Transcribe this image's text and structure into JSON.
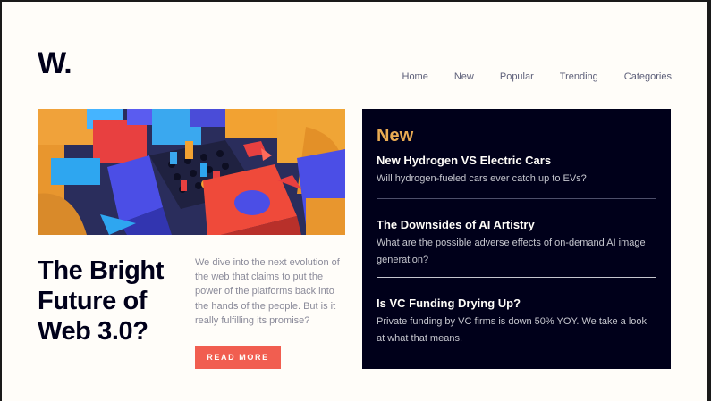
{
  "brand": {
    "logo": "W."
  },
  "nav": {
    "items": [
      {
        "label": "Home"
      },
      {
        "label": "New"
      },
      {
        "label": "Popular"
      },
      {
        "label": "Trending"
      },
      {
        "label": "Categories"
      }
    ]
  },
  "hero": {
    "title": "The Bright Future of Web 3.0?",
    "summary": "We dive into the next evolution of the web that claims to put the power of the platforms back into the hands of the people. But is it really fulfilling its promise?",
    "cta_label": "READ MORE"
  },
  "new_panel": {
    "heading": "New",
    "items": [
      {
        "title": "New Hydrogen VS Electric Cars",
        "summary": "Will hydrogen-fueled cars ever catch up to EVs?"
      },
      {
        "title": "The Downsides of AI Artistry",
        "summary": "What are the possible adverse effects of on-demand AI image generation?"
      },
      {
        "title": "Is VC Funding Drying Up?",
        "summary": "Private funding by VC firms is down 50% YOY. We take a look at what that means."
      }
    ]
  },
  "colors": {
    "background": "#fffdf9",
    "dark_navy": "#00001a",
    "accent_orange": "#e9ab53",
    "cta_red": "#f15e50",
    "muted_text": "#8a8a99"
  }
}
